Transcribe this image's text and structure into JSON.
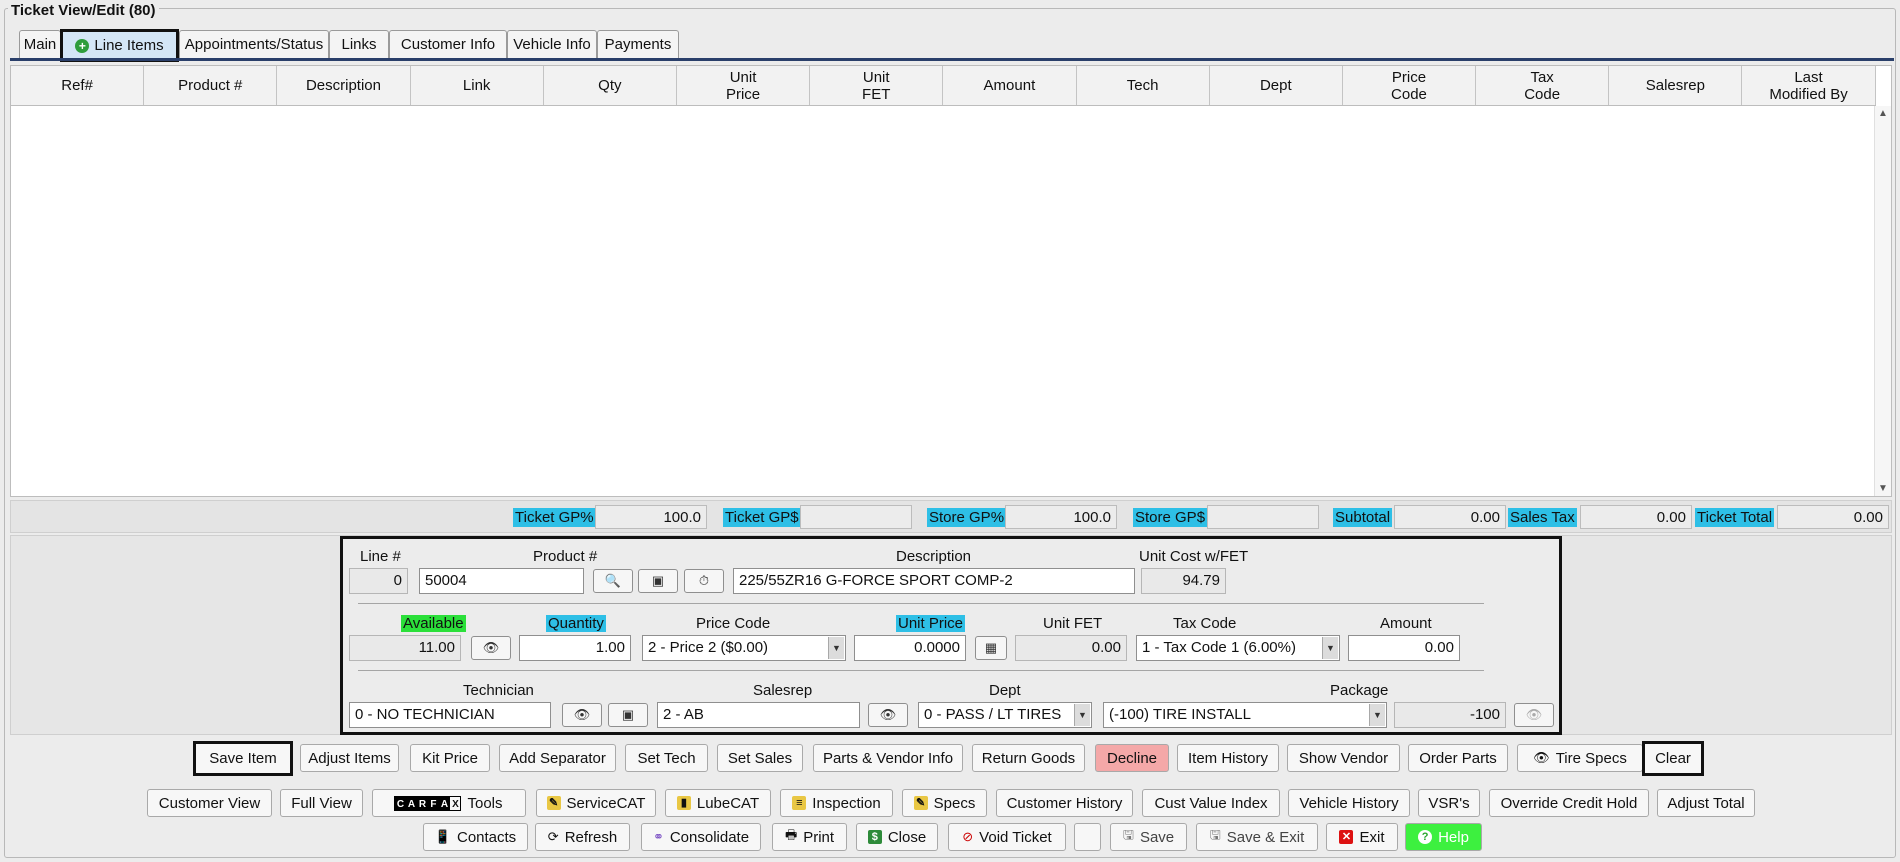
{
  "window": {
    "title": "Ticket View/Edit  (80)"
  },
  "tabs": [
    {
      "label": "Main"
    },
    {
      "label": "Line Items",
      "active": true
    },
    {
      "label": "Appointments/Status"
    },
    {
      "label": "Links"
    },
    {
      "label": "Customer Info"
    },
    {
      "label": "Vehicle Info"
    },
    {
      "label": "Payments"
    }
  ],
  "grid": {
    "columns": [
      {
        "line1": "Ref#",
        "line2": ""
      },
      {
        "line1": "Product #",
        "line2": ""
      },
      {
        "line1": "Description",
        "line2": ""
      },
      {
        "line1": "Link",
        "line2": ""
      },
      {
        "line1": "Qty",
        "line2": ""
      },
      {
        "line1": "Unit",
        "line2": "Price"
      },
      {
        "line1": "Unit",
        "line2": "FET"
      },
      {
        "line1": "Amount",
        "line2": ""
      },
      {
        "line1": "Tech",
        "line2": ""
      },
      {
        "line1": "Dept",
        "line2": ""
      },
      {
        "line1": "Price",
        "line2": "Code"
      },
      {
        "line1": "Tax",
        "line2": "Code"
      },
      {
        "line1": "Salesrep",
        "line2": ""
      },
      {
        "line1": "Last",
        "line2": "Modified By"
      }
    ],
    "rows": []
  },
  "totals": {
    "ticket_gp_pct_label": "Ticket GP%",
    "ticket_gp_pct": "100.0",
    "ticket_gp_dollar_label": "Ticket GP$",
    "ticket_gp_dollar": "",
    "store_gp_pct_label": "Store GP%",
    "store_gp_pct": "100.0",
    "store_gp_dollar_label": "Store GP$",
    "store_gp_dollar": "",
    "subtotal_label": "Subtotal",
    "subtotal": "0.00",
    "sales_tax_label": "Sales Tax",
    "sales_tax": "0.00",
    "ticket_total_label": "Ticket Total",
    "ticket_total": "0.00"
  },
  "editor": {
    "line_label": "Line #",
    "line": "0",
    "product_label": "Product #",
    "product": "50004",
    "description_label": "Description",
    "description": "225/55ZR16   G-FORCE SPORT COMP-2",
    "unit_cost_label": "Unit Cost w/FET",
    "unit_cost": "94.79",
    "available_label": "Available",
    "available": "11.00",
    "quantity_label": "Quantity",
    "quantity": "1.00",
    "price_code_label": "Price Code",
    "price_code": "2 - Price 2 ($0.00)",
    "unit_price_label": "Unit Price",
    "unit_price": "0.0000",
    "unit_fet_label": "Unit FET",
    "unit_fet": "0.00",
    "tax_code_label": "Tax Code",
    "tax_code": "1 - Tax Code 1 (6.00%)",
    "amount_label": "Amount",
    "amount": "0.00",
    "technician_label": "Technician",
    "technician": "0 - NO TECHNICIAN",
    "salesrep_label": "Salesrep",
    "salesrep": "2 - AB",
    "dept_label": "Dept",
    "dept": "0 - PASS / LT TIRES",
    "package_label": "Package",
    "package": "(-100) TIRE INSTALL",
    "package_code": "-100"
  },
  "item_actions": {
    "save_item": "Save Item",
    "adjust_items": "Adjust Items",
    "kit_price": "Kit Price",
    "add_separator": "Add Separator",
    "set_tech": "Set Tech",
    "set_sales": "Set Sales",
    "parts_vendor_info": "Parts & Vendor Info",
    "return_goods": "Return Goods",
    "decline": "Decline",
    "item_history": "Item History",
    "show_vendor": "Show Vendor",
    "order_parts": "Order Parts",
    "tire_specs": "Tire Specs",
    "clear": "Clear"
  },
  "toolbar1": {
    "customer_view": "Customer View",
    "full_view": "Full View",
    "carfax_tools": "Tools",
    "carfax_logo_letters": [
      "C",
      "A",
      "R",
      "F",
      "A",
      "X"
    ],
    "servicecat": "ServiceCAT",
    "lubecat": "LubeCAT",
    "inspection": "Inspection",
    "specs": "Specs",
    "customer_history": "Customer History",
    "cust_value_index": "Cust Value Index",
    "vehicle_history": "Vehicle History",
    "vsrs": "VSR's",
    "override_credit_hold": "Override Credit Hold",
    "adjust_total": "Adjust Total"
  },
  "toolbar2": {
    "contacts": "Contacts",
    "refresh": "Refresh",
    "consolidate": "Consolidate",
    "print": "Print",
    "close": "Close",
    "void_ticket": "Void Ticket",
    "save": "Save",
    "save_exit": "Save & Exit",
    "exit": "Exit",
    "help": "Help"
  },
  "colors": {
    "highlight_blue": "#2ebfe6",
    "highlight_green": "#2be03a",
    "help_green": "#3df03f",
    "decline_red": "#f4a8a8"
  }
}
